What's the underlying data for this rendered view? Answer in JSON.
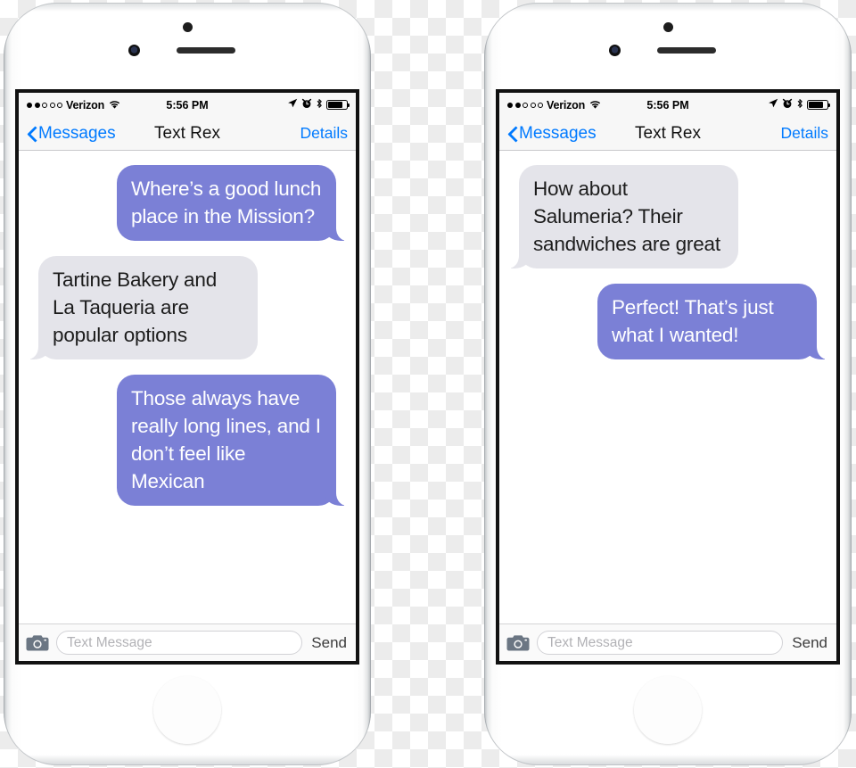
{
  "phones": [
    {
      "id": "phone-left",
      "status_bar": {
        "signal_dots_filled": 2,
        "signal_dots_total": 5,
        "carrier": "Verizon",
        "wifi_icon": "wifi-icon",
        "time": "5:56 PM",
        "location_icon": "location-arrow-icon",
        "alarm_icon": "alarm-clock-icon",
        "bluetooth_icon": "bluetooth-icon",
        "battery_icon": "battery-icon",
        "battery_level_percent": 80
      },
      "nav_bar": {
        "back_icon": "chevron-left-icon",
        "back_label": "Messages",
        "title": "Text Rex",
        "action_label": "Details"
      },
      "messages": [
        {
          "side": "out",
          "text": "Where’s a good lunch place in the Mission?"
        },
        {
          "side": "in",
          "text": "Tartine Bakery and La Taqueria are popular options"
        },
        {
          "side": "out",
          "text": "Those always have really long lines, and I don’t feel like Mexican"
        }
      ],
      "composer": {
        "camera_icon": "camera-icon",
        "placeholder": "Text Message",
        "value": "",
        "send_label": "Send"
      }
    },
    {
      "id": "phone-right",
      "status_bar": {
        "signal_dots_filled": 2,
        "signal_dots_total": 5,
        "carrier": "Verizon",
        "wifi_icon": "wifi-icon",
        "time": "5:56 PM",
        "location_icon": "location-arrow-icon",
        "alarm_icon": "alarm-clock-icon",
        "bluetooth_icon": "bluetooth-icon",
        "battery_icon": "battery-icon",
        "battery_level_percent": 80
      },
      "nav_bar": {
        "back_icon": "chevron-left-icon",
        "back_label": "Messages",
        "title": "Text Rex",
        "action_label": "Details"
      },
      "messages": [
        {
          "side": "in",
          "text": "How about Salumeria? Their sandwiches are great"
        },
        {
          "side": "out",
          "text": "Perfect! That’s just what I wanted!"
        }
      ],
      "composer": {
        "camera_icon": "camera-icon",
        "placeholder": "Text Message",
        "value": "",
        "send_label": "Send"
      }
    }
  ],
  "colors": {
    "outgoing_bubble": "#7b80d6",
    "incoming_bubble": "#e4e4ea",
    "ios_blue": "#007aff",
    "nav_background": "#f7f7f7",
    "screen_background": "#ffffff",
    "device_body": "#ffffff",
    "bezel": "#121212"
  }
}
